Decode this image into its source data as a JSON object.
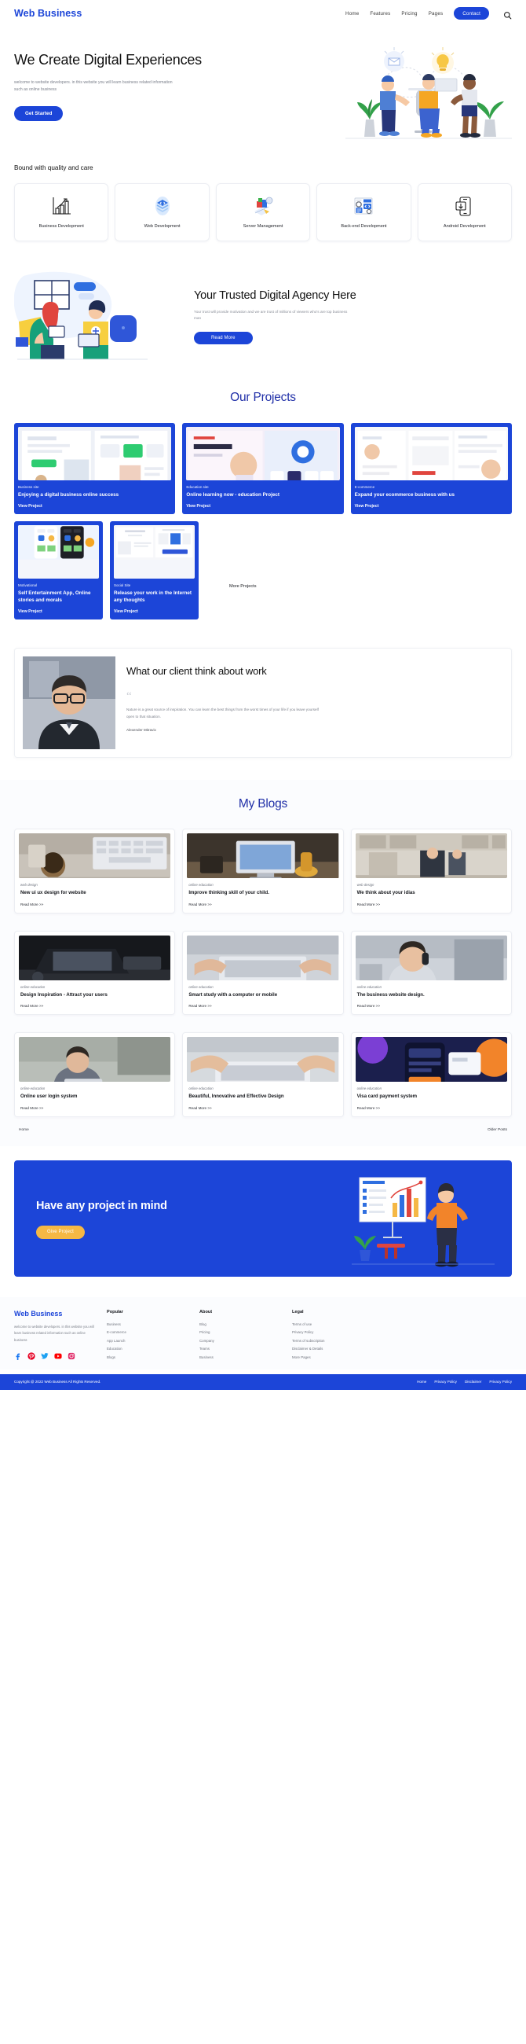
{
  "header": {
    "brand": "Web Business",
    "nav": [
      {
        "label": "Home"
      },
      {
        "label": "Features"
      },
      {
        "label": "Pricing"
      },
      {
        "label": "Pages"
      }
    ],
    "contact_label": "Contact",
    "search_icon": "search-icon"
  },
  "hero": {
    "title": "We Create Digital Experiences",
    "paragraph": "welcome to website developers. in this website you will learn business related information such as online business",
    "cta_label": "Get Started"
  },
  "services": {
    "title": "Bound with quality and care",
    "cards": [
      {
        "label": "Business Development",
        "icon": "bar-chart-growth-icon"
      },
      {
        "label": "Web Development",
        "icon": "code-layers-icon"
      },
      {
        "label": "Server Management",
        "icon": "server-boxes-icon"
      },
      {
        "label": "Back-end Development",
        "icon": "browser-gear-code-icon"
      },
      {
        "label": "Android Development",
        "icon": "mobile-download-icon"
      }
    ]
  },
  "trusted": {
    "title": "Your Trusted Digital Agency Here",
    "paragraph": "Your trust will provide motivation and we are trust of millions of viewers who's are top business man",
    "cta_label": "Read More"
  },
  "projects": {
    "title": "Our Projects",
    "view_label": "View Project",
    "more_label": "More Projects",
    "row1": [
      {
        "tag": "Business site",
        "name": "Enjoying a digital business online success"
      },
      {
        "tag": "Education site",
        "name": "Online learning now - education Project"
      },
      {
        "tag": "E-commerce",
        "name": "Expand your ecommerce business with us"
      }
    ],
    "row2": [
      {
        "tag": "Motivational",
        "name": "Self Entertainment App, Online stories and morals"
      },
      {
        "tag": "Social Site",
        "name": "Release your work in the Internet any thoughts"
      }
    ]
  },
  "testimonial": {
    "title": "What our client think about work",
    "quote_glyph": "“",
    "text": "Nature is a great source of inspiration. You can learn the best things from the worst times of your life if you leave yourself open to that situation.",
    "author": "Alexender Mitravix"
  },
  "blogs": {
    "title": "My Blogs",
    "read_label": "Read More >>",
    "items": [
      {
        "tag": "web design",
        "title": "New ui ux design for website",
        "thumb": "desk-keyboard-plant"
      },
      {
        "tag": "online education",
        "title": "Improve thinking skill of your child.",
        "thumb": "laptop-desk-lamp"
      },
      {
        "tag": "web design",
        "title": "We think about your idias",
        "thumb": "office-people-standing"
      },
      {
        "tag": "online education",
        "title": "Design Inspiration - Attract your users",
        "thumb": "dark-laptop-desk"
      },
      {
        "tag": "online education",
        "title": "Smart study with a computer or mobile",
        "thumb": "hands-typing-laptop"
      },
      {
        "tag": "online education",
        "title": "The business website design.",
        "thumb": "woman-phone-office"
      },
      {
        "tag": "online education",
        "title": "Online user login system",
        "thumb": "man-with-laptop"
      },
      {
        "tag": "online education",
        "title": "Beautiful, Innovative and Effective Design",
        "thumb": "hands-on-keyboard"
      },
      {
        "tag": "online education",
        "title": "Visa card payment system",
        "thumb": "phone-payment-graphic"
      }
    ],
    "pager": {
      "home": "Home",
      "older": "Older Posts"
    }
  },
  "cta": {
    "title": "Have any project in mind",
    "button_label": "Give Project"
  },
  "footer": {
    "brand": "Web Business",
    "about": "welcome to website developers. in this website you will learn business related information such as online business",
    "social": [
      "facebook-icon",
      "pinterest-icon",
      "twitter-icon",
      "youtube-icon",
      "instagram-icon"
    ],
    "columns": [
      {
        "heading": "Popular",
        "items": [
          "Business",
          "E-commerce",
          "App Launch",
          "Education",
          "Blogs"
        ]
      },
      {
        "heading": "About",
        "items": [
          "Blog",
          "Pricing",
          "Company",
          "Teams",
          "Business"
        ]
      },
      {
        "heading": "Legal",
        "items": [
          "Terms of use",
          "Privacy Policy",
          "Terms of subscription",
          "Disclaimer & Details",
          "More Pages"
        ]
      }
    ],
    "copyright": "Copyright @ 2022 Web Business All Rights Reserved.",
    "links": [
      "Home",
      "Privacy Policy",
      "Disclaimer",
      "Privacy Policy"
    ]
  }
}
